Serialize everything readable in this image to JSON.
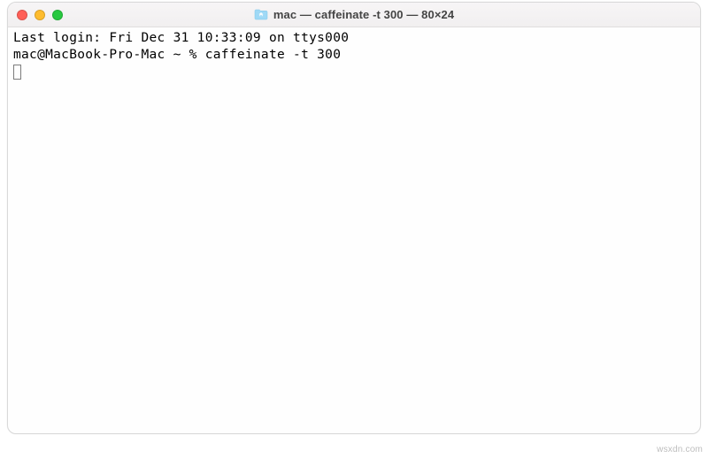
{
  "window": {
    "title": "mac — caffeinate -t 300 — 80×24"
  },
  "terminal": {
    "last_login": "Last login: Fri Dec 31 10:33:09 on ttys000",
    "prompt": "mac@MacBook-Pro-Mac ~ % ",
    "command": "caffeinate -t 300"
  },
  "watermark": "wsxdn.com"
}
